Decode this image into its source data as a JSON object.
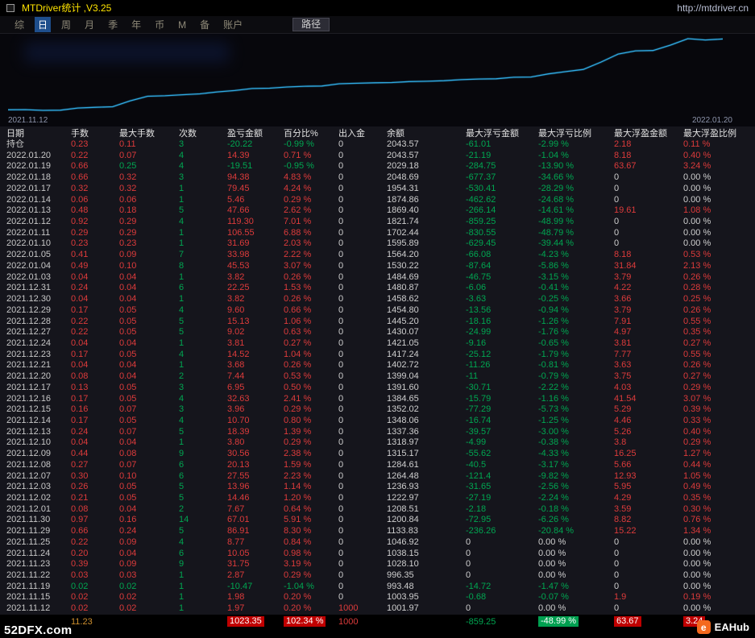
{
  "window": {
    "title": "MTDriver统计 ,V3.25",
    "url": "http://mtdriver.cn"
  },
  "menu": {
    "items": [
      "综",
      "日",
      "周",
      "月",
      "季",
      "年",
      "币",
      "M",
      "备",
      "账户"
    ],
    "active": "日",
    "path_button": "路径"
  },
  "chart_data": {
    "type": "line",
    "title": "余额曲线 (equity curve)",
    "x": [
      "2021.11.12",
      "2021.11.15",
      "2021.11.19",
      "2021.11.22",
      "2021.11.23",
      "2021.11.24",
      "2021.11.25",
      "2021.11.29",
      "2021.11.30",
      "2021.12.01",
      "2021.12.02",
      "2021.12.03",
      "2021.12.07",
      "2021.12.08",
      "2021.12.09",
      "2021.12.10",
      "2021.12.13",
      "2021.12.14",
      "2021.12.15",
      "2021.12.16",
      "2021.12.17",
      "2021.12.20",
      "2021.12.21",
      "2021.12.23",
      "2021.12.24",
      "2021.12.27",
      "2021.12.28",
      "2021.12.29",
      "2021.12.30",
      "2021.12.31",
      "2022.01.03",
      "2022.01.04",
      "2022.01.05",
      "2022.01.10",
      "2022.01.11",
      "2022.01.12",
      "2022.01.13",
      "2022.01.14",
      "2022.01.17",
      "2022.01.18",
      "2022.01.19",
      "2022.01.20"
    ],
    "series": [
      {
        "name": "余额",
        "values": [
          1001.97,
          1003.95,
          993.48,
          996.35,
          1028.1,
          1038.15,
          1046.92,
          1133.83,
          1200.84,
          1208.51,
          1222.97,
          1236.93,
          1264.48,
          1284.61,
          1315.17,
          1318.97,
          1337.36,
          1348.06,
          1352.02,
          1384.65,
          1391.6,
          1399.04,
          1402.72,
          1417.24,
          1421.05,
          1430.07,
          1445.2,
          1454.8,
          1458.62,
          1480.87,
          1484.69,
          1530.22,
          1564.2,
          1595.89,
          1702.44,
          1821.74,
          1869.4,
          1874.86,
          1954.31,
          2048.69,
          2029.18,
          2043.57
        ]
      }
    ],
    "ylim": [
      993.48,
      2048.69
    ],
    "grid": false,
    "legend": false,
    "line_color": "#2fa8e0",
    "start_label": "2021.11.12",
    "end_label": "2022.01.20"
  },
  "table": {
    "headers": [
      "日期",
      "手数",
      "最大手数",
      "次数",
      "盈亏金额",
      "百分比%",
      "出入金",
      "余额",
      "最大浮亏金额",
      "最大浮亏比例",
      "最大浮盈金额",
      "最大浮盈比例"
    ],
    "column_keys": [
      "date",
      "lots",
      "max-lots",
      "count",
      "profit",
      "percent",
      "deposit",
      "balance",
      "max-float-loss",
      "max-float-loss-pct",
      "max-float-profit",
      "max-float-profit-pct"
    ],
    "rows": [
      [
        "持仓",
        "0.23",
        "0.11",
        "3",
        "-20.22",
        "-0.99 %",
        "0",
        "2043.57",
        "-61.01",
        "-2.99 %",
        "2.18",
        "0.11 %"
      ],
      [
        "2022.01.20",
        "0.22",
        "0.07",
        "4",
        "14.39",
        "0.71 %",
        "0",
        "2043.57",
        "-21.19",
        "-1.04 %",
        "8.18",
        "0.40 %"
      ],
      [
        "2022.01.19",
        "0.66",
        "0.25",
        "4",
        "-19.51",
        "-0.95 %",
        "0",
        "2029.18",
        "-284.75",
        "-13.90 %",
        "63.67",
        "3.24 %"
      ],
      [
        "2022.01.18",
        "0.66",
        "0.32",
        "3",
        "94.38",
        "4.83 %",
        "0",
        "2048.69",
        "-677.37",
        "-34.66 %",
        "0",
        "0.00 %"
      ],
      [
        "2022.01.17",
        "0.32",
        "0.32",
        "1",
        "79.45",
        "4.24 %",
        "0",
        "1954.31",
        "-530.41",
        "-28.29 %",
        "0",
        "0.00 %"
      ],
      [
        "2022.01.14",
        "0.06",
        "0.06",
        "1",
        "5.46",
        "0.29 %",
        "0",
        "1874.86",
        "-462.62",
        "-24.68 %",
        "0",
        "0.00 %"
      ],
      [
        "2022.01.13",
        "0.48",
        "0.18",
        "5",
        "47.66",
        "2.62 %",
        "0",
        "1869.40",
        "-266.14",
        "-14.61 %",
        "19.61",
        "1.08 %"
      ],
      [
        "2022.01.12",
        "0.92",
        "0.29",
        "4",
        "119.30",
        "7.01 %",
        "0",
        "1821.74",
        "-859.25",
        "-48.99 %",
        "0",
        "0.00 %"
      ],
      [
        "2022.01.11",
        "0.29",
        "0.29",
        "1",
        "106.55",
        "6.88 %",
        "0",
        "1702.44",
        "-830.55",
        "-48.79 %",
        "0",
        "0.00 %"
      ],
      [
        "2022.01.10",
        "0.23",
        "0.23",
        "1",
        "31.69",
        "2.03 %",
        "0",
        "1595.89",
        "-629.45",
        "-39.44 %",
        "0",
        "0.00 %"
      ],
      [
        "2022.01.05",
        "0.41",
        "0.09",
        "7",
        "33.98",
        "2.22 %",
        "0",
        "1564.20",
        "-66.08",
        "-4.23 %",
        "8.18",
        "0.53 %"
      ],
      [
        "2022.01.04",
        "0.49",
        "0.10",
        "8",
        "45.53",
        "3.07 %",
        "0",
        "1530.22",
        "-87.64",
        "-5.86 %",
        "31.84",
        "2.13 %"
      ],
      [
        "2022.01.03",
        "0.04",
        "0.04",
        "1",
        "3.82",
        "0.26 %",
        "0",
        "1484.69",
        "-46.75",
        "-3.15 %",
        "3.79",
        "0.26 %"
      ],
      [
        "2021.12.31",
        "0.24",
        "0.04",
        "6",
        "22.25",
        "1.53 %",
        "0",
        "1480.87",
        "-6.06",
        "-0.41 %",
        "4.22",
        "0.28 %"
      ],
      [
        "2021.12.30",
        "0.04",
        "0.04",
        "1",
        "3.82",
        "0.26 %",
        "0",
        "1458.62",
        "-3.63",
        "-0.25 %",
        "3.66",
        "0.25 %"
      ],
      [
        "2021.12.29",
        "0.17",
        "0.05",
        "4",
        "9.60",
        "0.66 %",
        "0",
        "1454.80",
        "-13.56",
        "-0.94 %",
        "3.79",
        "0.26 %"
      ],
      [
        "2021.12.28",
        "0.22",
        "0.05",
        "5",
        "15.13",
        "1.06 %",
        "0",
        "1445.20",
        "-18.16",
        "-1.26 %",
        "7.91",
        "0.55 %"
      ],
      [
        "2021.12.27",
        "0.22",
        "0.05",
        "5",
        "9.02",
        "0.63 %",
        "0",
        "1430.07",
        "-24.99",
        "-1.76 %",
        "4.97",
        "0.35 %"
      ],
      [
        "2021.12.24",
        "0.04",
        "0.04",
        "1",
        "3.81",
        "0.27 %",
        "0",
        "1421.05",
        "-9.16",
        "-0.65 %",
        "3.81",
        "0.27 %"
      ],
      [
        "2021.12.23",
        "0.17",
        "0.05",
        "4",
        "14.52",
        "1.04 %",
        "0",
        "1417.24",
        "-25.12",
        "-1.79 %",
        "7.77",
        "0.55 %"
      ],
      [
        "2021.12.21",
        "0.04",
        "0.04",
        "1",
        "3.68",
        "0.26 %",
        "0",
        "1402.72",
        "-11.26",
        "-0.81 %",
        "3.63",
        "0.26 %"
      ],
      [
        "2021.12.20",
        "0.08",
        "0.04",
        "2",
        "7.44",
        "0.53 %",
        "0",
        "1399.04",
        "-11",
        "-0.79 %",
        "3.75",
        "0.27 %"
      ],
      [
        "2021.12.17",
        "0.13",
        "0.05",
        "3",
        "6.95",
        "0.50 %",
        "0",
        "1391.60",
        "-30.71",
        "-2.22 %",
        "4.03",
        "0.29 %"
      ],
      [
        "2021.12.16",
        "0.17",
        "0.05",
        "4",
        "32.63",
        "2.41 %",
        "0",
        "1384.65",
        "-15.79",
        "-1.16 %",
        "41.54",
        "3.07 %"
      ],
      [
        "2021.12.15",
        "0.16",
        "0.07",
        "3",
        "3.96",
        "0.29 %",
        "0",
        "1352.02",
        "-77.29",
        "-5.73 %",
        "5.29",
        "0.39 %"
      ],
      [
        "2021.12.14",
        "0.17",
        "0.05",
        "4",
        "10.70",
        "0.80 %",
        "0",
        "1348.06",
        "-16.74",
        "-1.25 %",
        "4.46",
        "0.33 %"
      ],
      [
        "2021.12.13",
        "0.24",
        "0.07",
        "5",
        "18.39",
        "1.39 %",
        "0",
        "1337.36",
        "-39.57",
        "-3.00 %",
        "5.26",
        "0.40 %"
      ],
      [
        "2021.12.10",
        "0.04",
        "0.04",
        "1",
        "3.80",
        "0.29 %",
        "0",
        "1318.97",
        "-4.99",
        "-0.38 %",
        "3.8",
        "0.29 %"
      ],
      [
        "2021.12.09",
        "0.44",
        "0.08",
        "9",
        "30.56",
        "2.38 %",
        "0",
        "1315.17",
        "-55.62",
        "-4.33 %",
        "16.25",
        "1.27 %"
      ],
      [
        "2021.12.08",
        "0.27",
        "0.07",
        "6",
        "20.13",
        "1.59 %",
        "0",
        "1284.61",
        "-40.5",
        "-3.17 %",
        "5.66",
        "0.44 %"
      ],
      [
        "2021.12.07",
        "0.30",
        "0.10",
        "6",
        "27.55",
        "2.23 %",
        "0",
        "1264.48",
        "-121.4",
        "-9.82 %",
        "12.93",
        "1.05 %"
      ],
      [
        "2021.12.03",
        "0.26",
        "0.05",
        "5",
        "13.96",
        "1.14 %",
        "0",
        "1236.93",
        "-31.65",
        "-2.56 %",
        "5.95",
        "0.49 %"
      ],
      [
        "2021.12.02",
        "0.21",
        "0.05",
        "5",
        "14.46",
        "1.20 %",
        "0",
        "1222.97",
        "-27.19",
        "-2.24 %",
        "4.29",
        "0.35 %"
      ],
      [
        "2021.12.01",
        "0.08",
        "0.04",
        "2",
        "7.67",
        "0.64 %",
        "0",
        "1208.51",
        "-2.18",
        "-0.18 %",
        "3.59",
        "0.30 %"
      ],
      [
        "2021.11.30",
        "0.97",
        "0.16",
        "14",
        "67.01",
        "5.91 %",
        "0",
        "1200.84",
        "-72.95",
        "-6.26 %",
        "8.82",
        "0.76 %"
      ],
      [
        "2021.11.29",
        "0.66",
        "0.24",
        "5",
        "86.91",
        "8.30 %",
        "0",
        "1133.83",
        "-236.26",
        "-20.84 %",
        "15.22",
        "1.34 %"
      ],
      [
        "2021.11.25",
        "0.22",
        "0.09",
        "4",
        "8.77",
        "0.84 %",
        "0",
        "1046.92",
        "0",
        "0.00 %",
        "0",
        "0.00 %"
      ],
      [
        "2021.11.24",
        "0.20",
        "0.04",
        "6",
        "10.05",
        "0.98 %",
        "0",
        "1038.15",
        "0",
        "0.00 %",
        "0",
        "0.00 %"
      ],
      [
        "2021.11.23",
        "0.39",
        "0.09",
        "9",
        "31.75",
        "3.19 %",
        "0",
        "1028.10",
        "0",
        "0.00 %",
        "0",
        "0.00 %"
      ],
      [
        "2021.11.22",
        "0.03",
        "0.03",
        "1",
        "2.87",
        "0.29 %",
        "0",
        "996.35",
        "0",
        "0.00 %",
        "0",
        "0.00 %"
      ],
      [
        "2021.11.19",
        "0.02",
        "0.02",
        "1",
        "-10.47",
        "-1.04 %",
        "0",
        "993.48",
        "-14.72",
        "-1.47 %",
        "0",
        "0.00 %"
      ],
      [
        "2021.11.15",
        "0.02",
        "0.02",
        "1",
        "1.98",
        "0.20 %",
        "0",
        "1003.95",
        "-0.68",
        "-0.07 %",
        "1.9",
        "0.19 %"
      ],
      [
        "2021.11.12",
        "0.02",
        "0.02",
        "1",
        "1.97",
        "0.20 %",
        "1000",
        "1001.97",
        "0",
        "0.00 %",
        "0",
        "0.00 %"
      ]
    ],
    "green_overrides": {
      "2022.01.19": [
        2
      ],
      "2021.11.19": [
        1,
        2
      ]
    },
    "totals": [
      "",
      "11.23",
      "",
      "",
      "1023.35",
      "102.34 %",
      "1000",
      "",
      "-859.25",
      "-48.99 %",
      "63.67",
      "3.24"
    ]
  },
  "footer": {
    "watermark": "52DFX.com",
    "brand": "EAHub",
    "brand_glyph": "e"
  },
  "colors": {
    "up_red": "#dd3b3b",
    "down_green": "#00a651",
    "neutral": "#cfcfcf",
    "date_text": "#c8c8c8",
    "count_green": "#00a651",
    "totals_orange": "#cd8f2e",
    "bg_red": "#c00000",
    "bg_green": "#00a050",
    "title_yellow": "#ffe400",
    "menu_active_bg": "#1e4e8c",
    "line_blue": "#2fa8e0"
  }
}
